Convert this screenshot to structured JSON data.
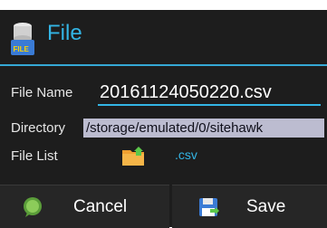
{
  "header": {
    "clipped_text": ""
  },
  "dialog": {
    "title": "File",
    "title_icon": "file-stack-icon",
    "accent": "#33b5e5"
  },
  "form": {
    "file_name_label": "File Name",
    "file_name_value": "20161124050220.csv",
    "directory_label": "Directory",
    "directory_value": "/storage/emulated/0/sitehawk",
    "file_list_label": "File List",
    "file_list_icon": "folder-icon",
    "file_filter": ".csv"
  },
  "buttons": {
    "cancel_label": "Cancel",
    "cancel_icon": "speech-bubble-icon",
    "save_label": "Save",
    "save_icon": "floppy-disk-icon"
  }
}
